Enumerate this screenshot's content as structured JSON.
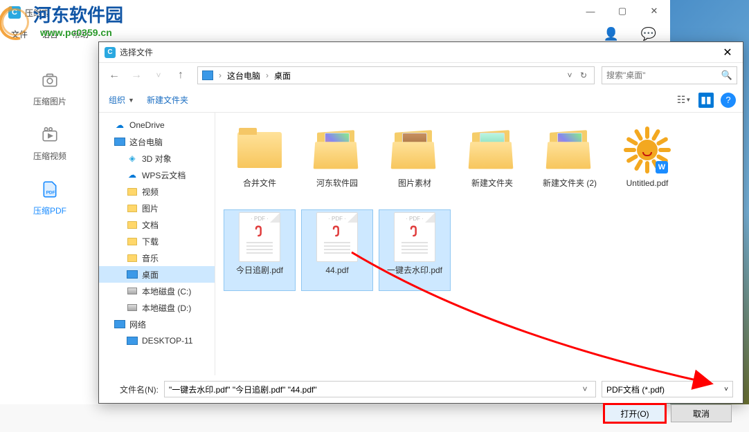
{
  "watermark": {
    "text": "河东软件园",
    "url": "www.pc0359.cn"
  },
  "app": {
    "title": "压缩宝",
    "menus": [
      "文件",
      "语言",
      "帮助"
    ],
    "sidebar": [
      {
        "label": "压缩图片",
        "icon": "camera-icon"
      },
      {
        "label": "压缩视频",
        "icon": "video-icon"
      },
      {
        "label": "压缩PDF",
        "icon": "pdf-icon"
      }
    ]
  },
  "dialog": {
    "title": "选择文件",
    "breadcrumb": {
      "root": "这台电脑",
      "current": "桌面"
    },
    "search_placeholder": "搜索\"桌面\"",
    "toolbar": {
      "organize": "组织",
      "newfolder": "新建文件夹"
    },
    "tree": [
      {
        "label": "OneDrive",
        "icon": "cloud",
        "level": 1
      },
      {
        "label": "这台电脑",
        "icon": "monitor",
        "level": 1
      },
      {
        "label": "3D 对象",
        "icon": "3d",
        "level": 2
      },
      {
        "label": "WPS云文档",
        "icon": "cloud",
        "level": 2
      },
      {
        "label": "视频",
        "icon": "folder",
        "level": 2
      },
      {
        "label": "图片",
        "icon": "folder",
        "level": 2
      },
      {
        "label": "文档",
        "icon": "folder",
        "level": 2
      },
      {
        "label": "下载",
        "icon": "folder",
        "level": 2
      },
      {
        "label": "音乐",
        "icon": "folder",
        "level": 2
      },
      {
        "label": "桌面",
        "icon": "monitor",
        "level": 2,
        "selected": true
      },
      {
        "label": "本地磁盘 (C:)",
        "icon": "disk",
        "level": 2
      },
      {
        "label": "本地磁盘 (D:)",
        "icon": "disk",
        "level": 2
      },
      {
        "label": "网络",
        "icon": "monitor",
        "level": 1
      },
      {
        "label": "DESKTOP-11",
        "icon": "monitor",
        "level": 2
      }
    ],
    "files": [
      {
        "label": "合并文件",
        "type": "folder-closed",
        "selected": false
      },
      {
        "label": "河东软件园",
        "type": "folder-open-mix",
        "selected": false
      },
      {
        "label": "图片素材",
        "type": "folder-open-dog",
        "selected": false
      },
      {
        "label": "新建文件夹",
        "type": "folder-open-green",
        "selected": false
      },
      {
        "label": "新建文件夹 (2)",
        "type": "folder-open-mix",
        "selected": false
      },
      {
        "label": "Untitled.pdf",
        "type": "sun",
        "selected": false
      },
      {
        "label": "今日追剧.pdf",
        "type": "pdf",
        "selected": true
      },
      {
        "label": "44.pdf",
        "type": "pdf",
        "selected": true
      },
      {
        "label": "一键去水印.pdf",
        "type": "pdf",
        "selected": true
      }
    ],
    "filename_label": "文件名(N):",
    "filename_value": "\"一键去水印.pdf\" \"今日追剧.pdf\" \"44.pdf\"",
    "filter": "PDF文档 (*.pdf)",
    "open_btn": "打开(O)",
    "cancel_btn": "取消"
  }
}
